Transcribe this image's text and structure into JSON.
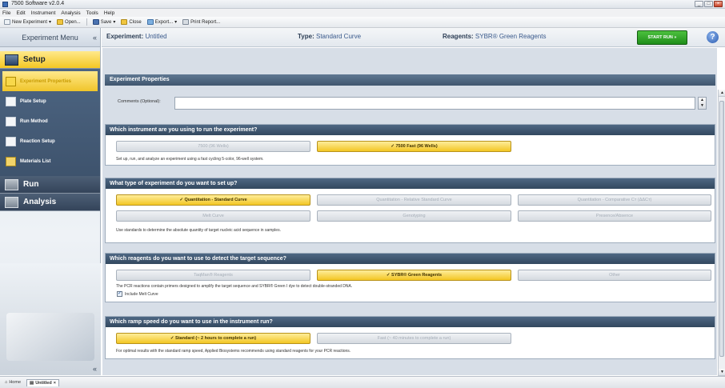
{
  "window": {
    "title": "7500 Software v2.0.4"
  },
  "menu": [
    "File",
    "Edit",
    "Instrument",
    "Analysis",
    "Tools",
    "Help"
  ],
  "toolbar": {
    "new_experiment": "New Experiment",
    "open": "Open...",
    "save": "Save",
    "close": "Close",
    "export": "Export...",
    "print_report": "Print Report..."
  },
  "sidebar": {
    "title": "Experiment Menu",
    "collapse": "«",
    "setup": "Setup",
    "setup_items": [
      {
        "label": "Experiment Properties",
        "icon": "properties-icon"
      },
      {
        "label": "Plate Setup",
        "icon": "plate-icon"
      },
      {
        "label": "Run Method",
        "icon": "run-method-icon"
      },
      {
        "label": "Reaction Setup",
        "icon": "reaction-icon"
      },
      {
        "label": "Materials List",
        "icon": "materials-icon"
      }
    ],
    "run": "Run",
    "analysis": "Analysis",
    "bottom_collapse": "«"
  },
  "header": {
    "experiment_label": "Experiment:",
    "experiment_value": "Untitled",
    "type_label": "Type:",
    "type_value": "Standard Curve",
    "reagents_label": "Reagents:",
    "reagents_value": "SYBR® Green Reagents",
    "start_run": "START RUN",
    "help": "?"
  },
  "experiment_properties": {
    "heading": "Experiment Properties",
    "comments_label": "Comments (Optional):",
    "comments_value": ""
  },
  "instrument": {
    "question": "Which instrument are you using to run the experiment?",
    "options": [
      "7500 (96 Wells)",
      "✓ 7500 Fast (96 Wells)"
    ],
    "selected": 1,
    "description": "Set up, run, and analyze an experiment using a fast cycling 5-color, 96-well system."
  },
  "experiment_type": {
    "question": "What type of experiment do you want to set up?",
    "options": [
      "✓ Quantitation - Standard Curve",
      "Quantitation - Relative Standard Curve",
      "Quantitation - Comparative Cт (ΔΔCт)",
      "Melt Curve",
      "Genotyping",
      "Presence/Absence"
    ],
    "selected": 0,
    "description": "Use standards to determine the absolute quantity of target nucleic acid sequence in samples."
  },
  "reagents": {
    "question": "Which reagents do you want to use to detect the target sequence?",
    "options": [
      "TaqMan® Reagents",
      "✓ SYBR® Green Reagents",
      "Other"
    ],
    "selected": 1,
    "description": "The PCR reactions contain primers designed to amplify the target sequence and SYBR® Green I dye to detect double-stranded DNA.",
    "include_melt_curve": "Include Melt Curve",
    "include_melt_curve_checked": true
  },
  "ramp": {
    "question": "Which ramp speed do you want to use in the instrument run?",
    "options": [
      "✓ Standard (~ 2 hours to complete a run)",
      "Fast (~ 40 minutes to complete a run)"
    ],
    "selected": 0,
    "description": "For optimal results with the standard ramp speed, Applied Biosystems recommends using standard reagents for your PCR reactions."
  },
  "tabs": [
    {
      "label": "Home",
      "icon": "home-icon"
    },
    {
      "label": "Untitled",
      "icon": "document-icon"
    }
  ],
  "colors": {
    "selected_option": "#f3c623",
    "panel_header": "#33485f",
    "start_run": "#1f8e1a"
  }
}
